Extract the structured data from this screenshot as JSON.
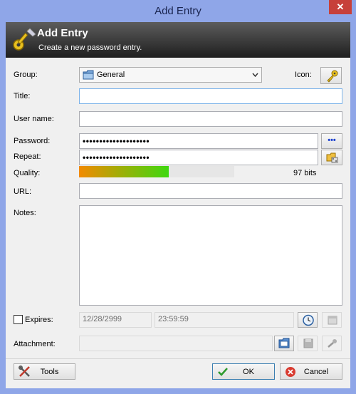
{
  "window": {
    "title": "Add Entry",
    "close_glyph": "✕"
  },
  "banner": {
    "title": "Add Entry",
    "subtitle": "Create a new password entry."
  },
  "group": {
    "label": "Group:",
    "value": "General"
  },
  "icon_label": "Icon:",
  "title_field": {
    "label": "Title:",
    "value": ""
  },
  "username": {
    "label": "User name:",
    "value": ""
  },
  "password": {
    "label": "Password:",
    "value": "••••••••••••••••••••"
  },
  "repeat": {
    "label": "Repeat:",
    "value": "••••••••••••••••••••"
  },
  "show_password_glyph": "•••",
  "quality": {
    "label": "Quality:",
    "level": 0.58,
    "value_text": "97 bits"
  },
  "url": {
    "label": "URL:",
    "value": ""
  },
  "notes": {
    "label": "Notes:",
    "value": ""
  },
  "expires": {
    "label": "Expires:",
    "checked": false,
    "date": "12/28/2999",
    "time": "23:59:59"
  },
  "attachment": {
    "label": "Attachment:",
    "value": ""
  },
  "buttons": {
    "tools": "Tools",
    "ok": "OK",
    "cancel": "Cancel"
  },
  "colors": {
    "titlebar": "#8fa6e8",
    "close": "#c7403a",
    "quality_start": "#f28a00",
    "quality_end": "#3ed80f",
    "banner_dark": "#1f1f1f"
  },
  "icons": [
    "key-icon",
    "folder-icon",
    "chevron-down-icon",
    "gear-key-icon",
    "dots-icon",
    "password-generator-icon",
    "clock-icon",
    "calendar-icon",
    "open-folder-icon",
    "save-icon",
    "attachment-tools-icon",
    "tools-icon",
    "checkmark-icon",
    "cancel-icon"
  ]
}
